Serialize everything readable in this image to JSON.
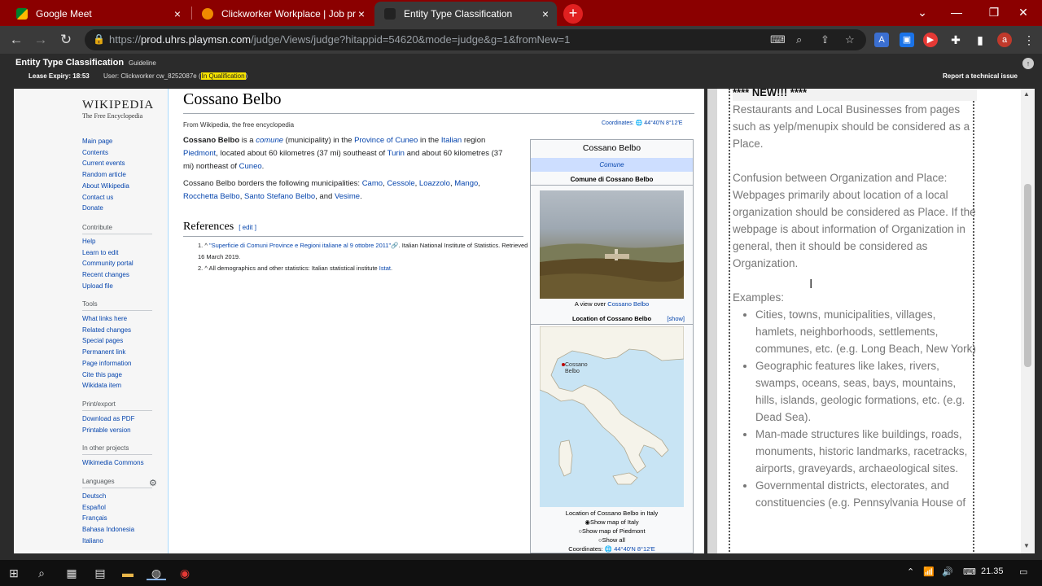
{
  "tabs": [
    {
      "label": "Google Meet",
      "close": "×"
    },
    {
      "label": "Clickworker Workplace | Job proc",
      "close": "×"
    },
    {
      "label": "Entity Type Classification",
      "close": "×"
    }
  ],
  "new_tab": "+",
  "window_controls": {
    "minimize": "—",
    "restore": "❐",
    "close": "✕",
    "dropdown": "⌄"
  },
  "nav": {
    "back": "←",
    "forward": "→",
    "reload": "↻"
  },
  "address": {
    "scheme": "https://",
    "host": "prod.uhrs.playmsn.com",
    "path": "/judge/Views/judge?hitappid=54620&mode=judge&g=1&fromNew=1"
  },
  "profile_initial": "a",
  "app": {
    "title": "Entity Type Classification",
    "guideline_link": "Guideline",
    "lease": "Lease Expiry: 18:53",
    "user_prefix": "User: Clickworker cw_8252087e (",
    "qualification": "In Qualification",
    "user_suffix": ")",
    "report": "Report a technical issue",
    "help": "↑"
  },
  "wiki": {
    "logo_title": "WIKIPEDIA",
    "logo_sub": "The Free Encyclopedia",
    "nav_links": [
      "Main page",
      "Contents",
      "Current events",
      "Random article",
      "About Wikipedia",
      "Contact us",
      "Donate"
    ],
    "contribute_head": "Contribute",
    "contribute_links": [
      "Help",
      "Learn to edit",
      "Community portal",
      "Recent changes",
      "Upload file"
    ],
    "tools_head": "Tools",
    "tools_links": [
      "What links here",
      "Related changes",
      "Special pages",
      "Permanent link",
      "Page information",
      "Cite this page",
      "Wikidata item"
    ],
    "print_head": "Print/export",
    "print_links": [
      "Download as PDF",
      "Printable version"
    ],
    "projects_head": "In other projects",
    "projects_links": [
      "Wikimedia Commons"
    ],
    "languages_head": "Languages",
    "language_links": [
      "Deutsch",
      "Español",
      "Français",
      "Bahasa Indonesia",
      "Italiano"
    ],
    "article_title": "Cossano Belbo",
    "from_line": "From Wikipedia, the free encyclopedia",
    "coordinates": "Coordinates: 🌐 44°40′N 8°12′E",
    "para1": {
      "b": "Cossano Belbo",
      "t1": " is a ",
      "a1": "comune",
      "t2": " (municipality) in the ",
      "a2": "Province of Cuneo",
      "t3": " in the ",
      "a3": "Italian",
      "t4": " region ",
      "a4": "Piedmont",
      "t5": ", located about 60 kilometres (37 mi) southeast of ",
      "a5": "Turin",
      "t6": " and about 60 kilometres (37 mi) northeast of ",
      "a6": "Cuneo",
      "t7": "."
    },
    "para2": {
      "t1": "Cossano Belbo borders the following municipalities: ",
      "a1": "Camo",
      "c1": ", ",
      "a2": "Cessole",
      "c2": ", ",
      "a3": "Loazzolo",
      "c3": ", ",
      "a4": "Mango",
      "c4": ", ",
      "a5": "Rocchetta Belbo",
      "c5": ", ",
      "a6": "Santo Stefano Belbo",
      "c6": ", and ",
      "a7": "Vesime",
      "c7": "."
    },
    "references_head": "References",
    "edit_label": "[ edit ]",
    "ref1": {
      "n": "1. ^ ",
      "a": "\"Superficie di Comuni Province e Regioni italiane al 9 ottobre 2011\"🔗",
      "t": ". Italian National Institute of Statistics. Retrieved 16 March 2019."
    },
    "ref2": {
      "n": "2. ^ ",
      "t": "All demographics and other statistics: Italian statistical institute ",
      "a": "Istat",
      "end": "."
    },
    "infobox": {
      "title": "Cossano Belbo",
      "type": "Comune",
      "subtitle": "Comune di Cossano Belbo",
      "caption_prefix": "A view over ",
      "caption_link": "Cossano Belbo",
      "location": "Location of Cossano Belbo",
      "show": "[show]",
      "map_label": "Cossano Belbo",
      "map_caption": "Location of Cossano Belbo in Italy",
      "radio1": "Show map of Italy",
      "radio2": "Show map of Piedmont",
      "radio3": "Show all",
      "coord_label": "Coordinates: ",
      "coord_value": "🌐 44°40′N 8°12′E"
    }
  },
  "guideline": {
    "new_header": "**** NEW!!! ****",
    "p1": "Restaurants and Local Businesses from pages such as yelp/menupix should be considered as a Place.",
    "p2": "Confusion between Organization and Place: Webpages primarily about location of a local organization should be considered as Place. If the webpage is about information of Organization in general, then it should be considered as Organization.",
    "examples_label": "Examples:",
    "examples": [
      "Cities, towns, municipalities, villages, hamlets, neighborhoods, settlements, communes, etc. (e.g. Long Beach, New York)",
      "Geographic features like lakes, rivers, swamps, oceans, seas, bays, mountains, hills, islands, geologic formations, etc. (e.g. Dead Sea).",
      "Man-made structures like buildings, roads, monuments, historic landmarks, racetracks, airports, graveyards, archaeological sites.",
      "Governmental districts, electorates, and constituencies (e.g. Pennsylvania House of"
    ],
    "cursor": "I"
  },
  "taskbar": {
    "start": "⊞",
    "search": "⌕",
    "clock": "21.35",
    "tray_up": "⌃",
    "wifi": "📶",
    "volume": "🔊"
  }
}
